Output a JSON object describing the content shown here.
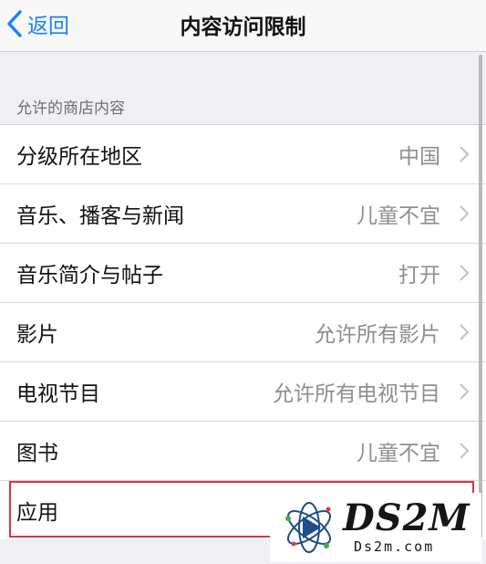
{
  "navbar": {
    "back_label": "返回",
    "title": "内容访问限制"
  },
  "section": {
    "header": "允许的商店内容"
  },
  "rows": [
    {
      "label": "分级所在地区",
      "value": "中国"
    },
    {
      "label": "音乐、播客与新闻",
      "value": "儿童不宜"
    },
    {
      "label": "音乐简介与帖子",
      "value": "打开"
    },
    {
      "label": "影片",
      "value": "允许所有影片"
    },
    {
      "label": "电视节目",
      "value": "允许所有电视节目"
    },
    {
      "label": "图书",
      "value": "儿童不宜"
    },
    {
      "label": "应用",
      "value": ""
    }
  ],
  "watermark": {
    "brand": "DS2M",
    "domain": "Ds2m.com"
  },
  "colors": {
    "accent": "#1a82fb",
    "highlight": "#d9363e",
    "secondary_text": "#8e8e93",
    "background": "#efeff4"
  }
}
